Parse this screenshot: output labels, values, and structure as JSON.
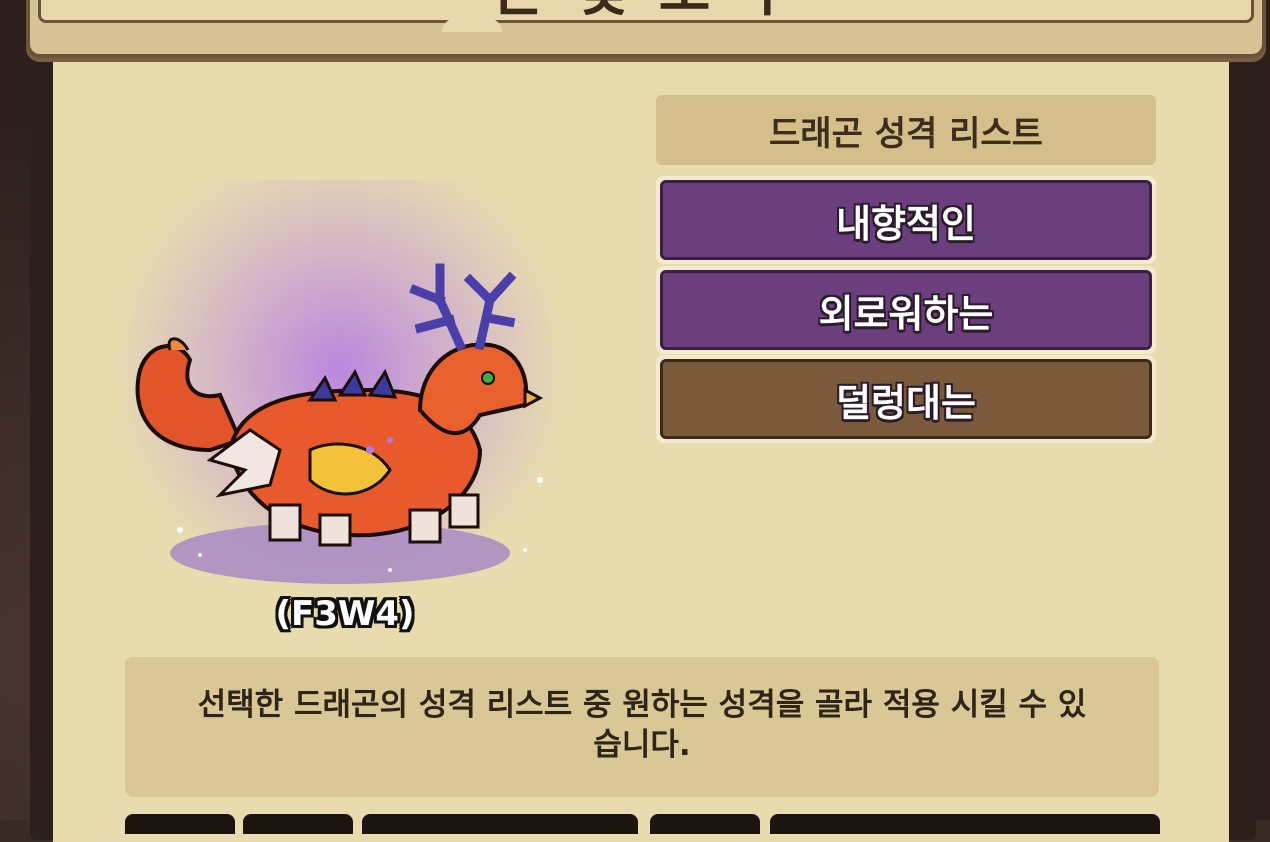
{
  "window": {
    "title": "은 및 도 구"
  },
  "dragon": {
    "code": "(F3W4)"
  },
  "personality": {
    "header": "드래곤 성격 리스트",
    "traits": [
      {
        "label": "내향적인",
        "color": "#6b3f7e"
      },
      {
        "label": "외로워하는",
        "color": "#6b3f7e"
      },
      {
        "label": "덜렁대는",
        "color": "#7a5a3a"
      }
    ]
  },
  "description": {
    "text": "선택한 드래곤의 성격 리스트 중 원하는 성격을 골라 적용 시킬 수 있습니다."
  }
}
